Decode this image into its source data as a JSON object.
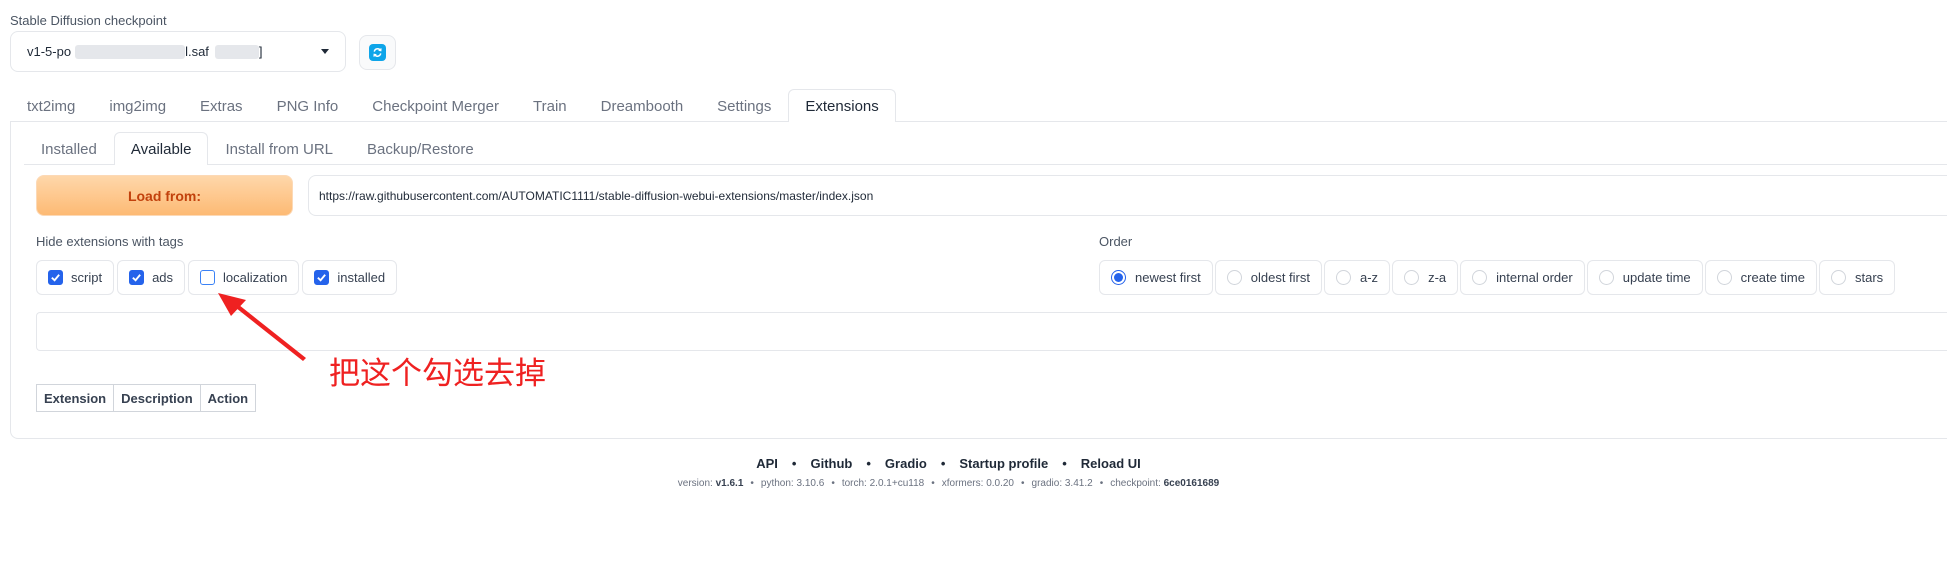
{
  "checkpoint": {
    "label": "Stable Diffusion checkpoint",
    "value_prefix": "v1-5-po",
    "value_mid": "l.saf",
    "value_suffix": "]"
  },
  "main_tabs": [
    "txt2img",
    "img2img",
    "Extras",
    "PNG Info",
    "Checkpoint Merger",
    "Train",
    "Dreambooth",
    "Settings",
    "Extensions"
  ],
  "sub_tabs": [
    "Installed",
    "Available",
    "Install from URL",
    "Backup/Restore"
  ],
  "load": {
    "button_label": "Load from:",
    "url": "https://raw.githubusercontent.com/AUTOMATIC1111/stable-diffusion-webui-extensions/master/index.json"
  },
  "hide_tags": {
    "label": "Hide extensions with tags",
    "items": [
      {
        "label": "script",
        "checked": true
      },
      {
        "label": "ads",
        "checked": true
      },
      {
        "label": "localization",
        "checked": false
      },
      {
        "label": "installed",
        "checked": true
      }
    ]
  },
  "order": {
    "label": "Order",
    "items": [
      {
        "label": "newest first",
        "selected": true
      },
      {
        "label": "oldest first",
        "selected": false
      },
      {
        "label": "a-z",
        "selected": false
      },
      {
        "label": "z-a",
        "selected": false
      },
      {
        "label": "internal order",
        "selected": false
      },
      {
        "label": "update time",
        "selected": false
      },
      {
        "label": "create time",
        "selected": false
      },
      {
        "label": "stars",
        "selected": false
      }
    ]
  },
  "table": {
    "headers": [
      "Extension",
      "Description",
      "Action"
    ]
  },
  "annotation": "把这个勾选去掉",
  "footer": {
    "links": [
      "API",
      "Github",
      "Gradio",
      "Startup profile",
      "Reload UI"
    ],
    "version_label": "version:",
    "version": "v1.6.1",
    "python_label": "python:",
    "python": "3.10.6",
    "torch_label": "torch:",
    "torch": "2.0.1+cu118",
    "xformers_label": "xformers:",
    "xformers": "0.0.20",
    "gradio_label": "gradio:",
    "gradio": "3.41.2",
    "checkpoint_label": "checkpoint:",
    "checkpoint": "6ce0161689"
  },
  "colors": {
    "accent": "#2563eb",
    "annotation": "#ef2121",
    "load_button": "#fdba74"
  }
}
